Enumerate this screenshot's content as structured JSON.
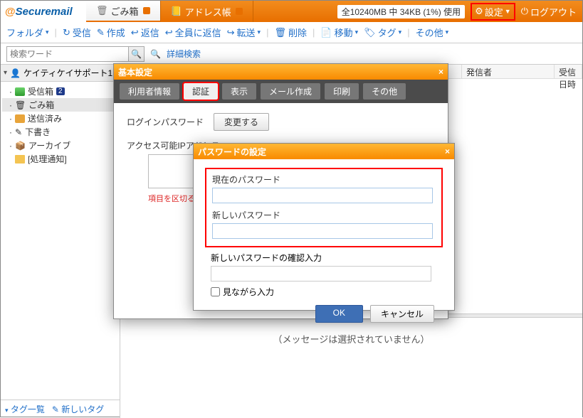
{
  "brand": {
    "at": "@",
    "name": "Securemail"
  },
  "tabs": {
    "trash": "ごみ箱",
    "address": "アドレス帳"
  },
  "top": {
    "quota": "全10240MB 中 34KB (1%) 使用",
    "settings": "設定",
    "logout": "ログアウト"
  },
  "tb": {
    "folder": "フォルダ",
    "receive": "受信",
    "compose": "作成",
    "reply": "返信",
    "replyall": "全員に返信",
    "forward": "転送",
    "delete": "削除",
    "move": "移動",
    "tag": "タグ",
    "other": "その他"
  },
  "search": {
    "placeholder": "検索ワード",
    "adv": "詳細検索"
  },
  "account": "ケイティケイサポート1",
  "folders": {
    "inbox": "受信箱",
    "inbox_badge": "2",
    "trash": "ごみ箱",
    "sent": "送信済み",
    "draft": "下書き",
    "archive": "アーカイブ",
    "proc": "[処理通知]"
  },
  "side": {
    "taglist": "タグ一覧",
    "newtag": "新しいタグ"
  },
  "cols": {
    "sender": "発信者",
    "date": "受信日時"
  },
  "nosel": "（メッセージは選択されていません）",
  "dlg1": {
    "title": "基本設定",
    "tabs": {
      "user": "利用者情報",
      "auth": "認証",
      "view": "表示",
      "compose": "メール作成",
      "print": "印刷",
      "other": "その他"
    },
    "loginpw": "ログインパスワード",
    "change": "変更する",
    "iplabel": "アクセス可能IPアドレス",
    "hint": "項目を区切るには"
  },
  "dlg2": {
    "title": "パスワードの設定",
    "current": "現在のパスワード",
    "new": "新しいパスワード",
    "confirm": "新しいパスワードの確認入力",
    "show": "見ながら入力",
    "ok": "OK",
    "cancel": "キャンセル"
  }
}
